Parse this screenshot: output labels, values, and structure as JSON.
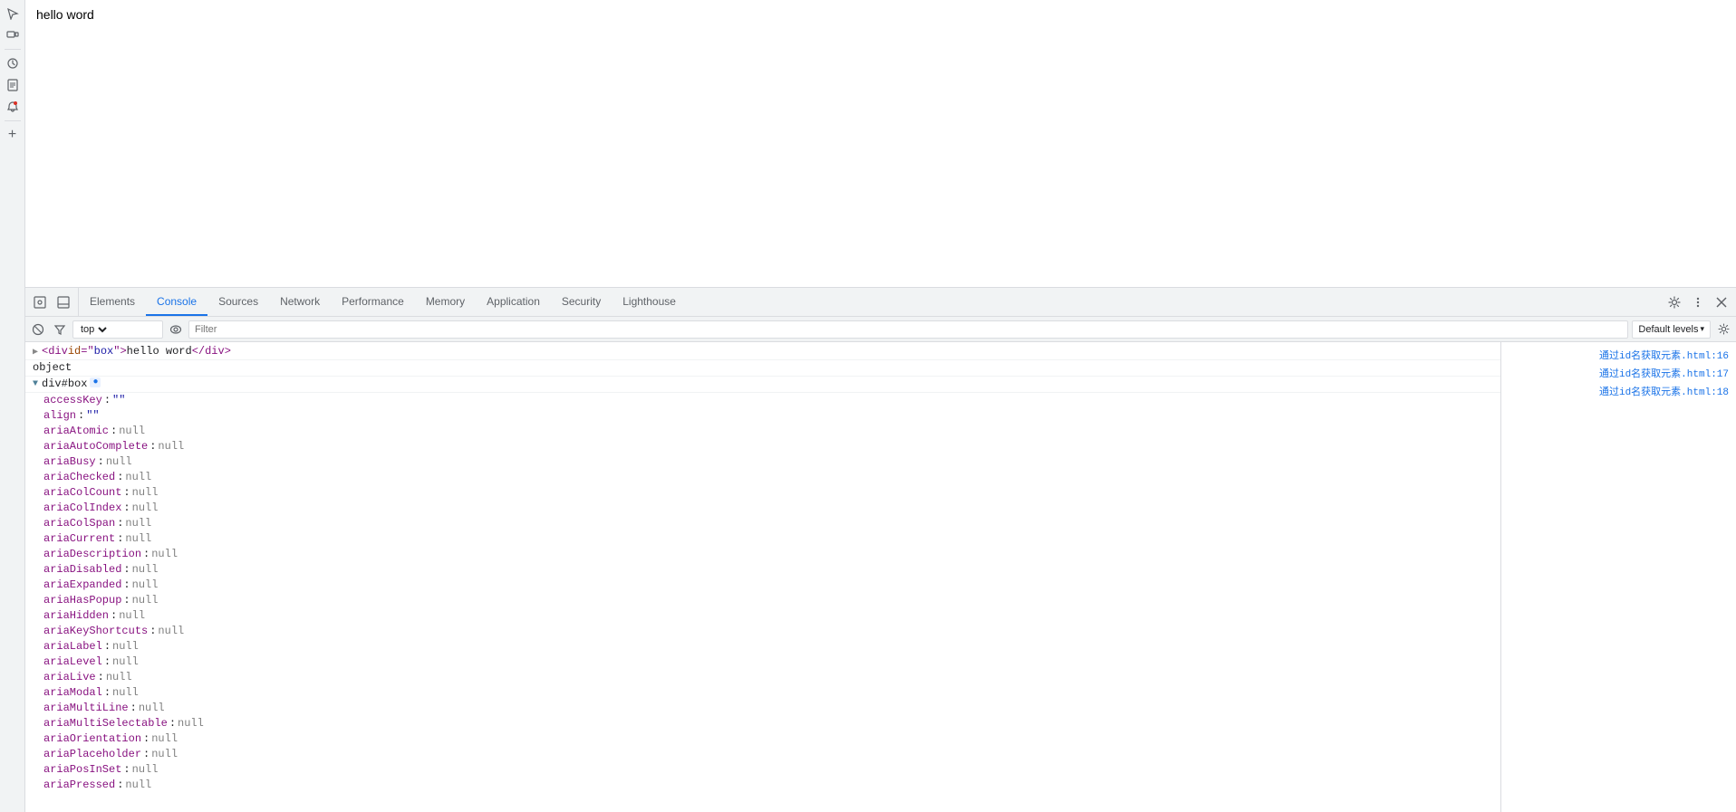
{
  "page": {
    "title": "hello word"
  },
  "sidebar": {
    "icons": [
      {
        "name": "cursor-icon",
        "symbol": "⊹",
        "tooltip": "Select element"
      },
      {
        "name": "device-icon",
        "symbol": "▭",
        "tooltip": "Device toolbar"
      },
      {
        "name": "history-icon",
        "symbol": "🕐",
        "tooltip": "Recent"
      },
      {
        "name": "snippets-icon",
        "symbol": "📄",
        "tooltip": "Snippets"
      },
      {
        "name": "notification-icon",
        "symbol": "🔔",
        "tooltip": "Notifications"
      },
      {
        "name": "plus-icon",
        "symbol": "+",
        "tooltip": "More tabs"
      }
    ]
  },
  "devtools": {
    "tabs": [
      {
        "id": "elements",
        "label": "Elements",
        "active": false
      },
      {
        "id": "console",
        "label": "Console",
        "active": true
      },
      {
        "id": "sources",
        "label": "Sources",
        "active": false
      },
      {
        "id": "network",
        "label": "Network",
        "active": false
      },
      {
        "id": "performance",
        "label": "Performance",
        "active": false
      },
      {
        "id": "memory",
        "label": "Memory",
        "active": false
      },
      {
        "id": "application",
        "label": "Application",
        "active": false
      },
      {
        "id": "security",
        "label": "Security",
        "active": false
      },
      {
        "id": "lighthouse",
        "label": "Lighthouse",
        "active": false
      }
    ],
    "toolbar_right": {
      "settings_label": "⚙",
      "more_label": "⋮",
      "close_label": "✕"
    },
    "console": {
      "context": "top",
      "filter_placeholder": "Filter",
      "log_levels": "Default levels",
      "html_tag": "<div id=\"box\">hello word</div>",
      "object_label": "object",
      "object_name": "div#box",
      "properties": [
        {
          "key": "accessKey",
          "value": "\"\"",
          "type": "string"
        },
        {
          "key": "align",
          "value": "\"\"",
          "type": "string"
        },
        {
          "key": "ariaAtomic",
          "value": "null",
          "type": "null"
        },
        {
          "key": "ariaAutoComplete",
          "value": "null",
          "type": "null"
        },
        {
          "key": "ariaBusy",
          "value": "null",
          "type": "null"
        },
        {
          "key": "ariaChecked",
          "value": "null",
          "type": "null"
        },
        {
          "key": "ariaColCount",
          "value": "null",
          "type": "null"
        },
        {
          "key": "ariaColIndex",
          "value": "null",
          "type": "null"
        },
        {
          "key": "ariaColSpan",
          "value": "null",
          "type": "null"
        },
        {
          "key": "ariaCurrent",
          "value": "null",
          "type": "null"
        },
        {
          "key": "ariaDescription",
          "value": "null",
          "type": "null"
        },
        {
          "key": "ariaDisabled",
          "value": "null",
          "type": "null"
        },
        {
          "key": "ariaExpanded",
          "value": "null",
          "type": "null"
        },
        {
          "key": "ariaHasPopup",
          "value": "null",
          "type": "null"
        },
        {
          "key": "ariaHidden",
          "value": "null",
          "type": "null"
        },
        {
          "key": "ariaKeyShortcuts",
          "value": "null",
          "type": "null"
        },
        {
          "key": "ariaLabel",
          "value": "null",
          "type": "null"
        },
        {
          "key": "ariaLevel",
          "value": "null",
          "type": "null"
        },
        {
          "key": "ariaLive",
          "value": "null",
          "type": "null"
        },
        {
          "key": "ariaModal",
          "value": "null",
          "type": "null"
        },
        {
          "key": "ariaMultiLine",
          "value": "null",
          "type": "null"
        },
        {
          "key": "ariaMultiSelectable",
          "value": "null",
          "type": "null"
        },
        {
          "key": "ariaOrientation",
          "value": "null",
          "type": "null"
        },
        {
          "key": "ariaPlaceholder",
          "value": "null",
          "type": "null"
        },
        {
          "key": "ariaPosInSet",
          "value": "null",
          "type": "null"
        },
        {
          "key": "ariaPressed",
          "value": "null",
          "type": "null"
        }
      ],
      "right_links": [
        {
          "text": "通过id名获取元素.html:16"
        },
        {
          "text": "通过id名获取元素.html:17"
        },
        {
          "text": "通过id名获取元素.html:18"
        }
      ]
    }
  }
}
